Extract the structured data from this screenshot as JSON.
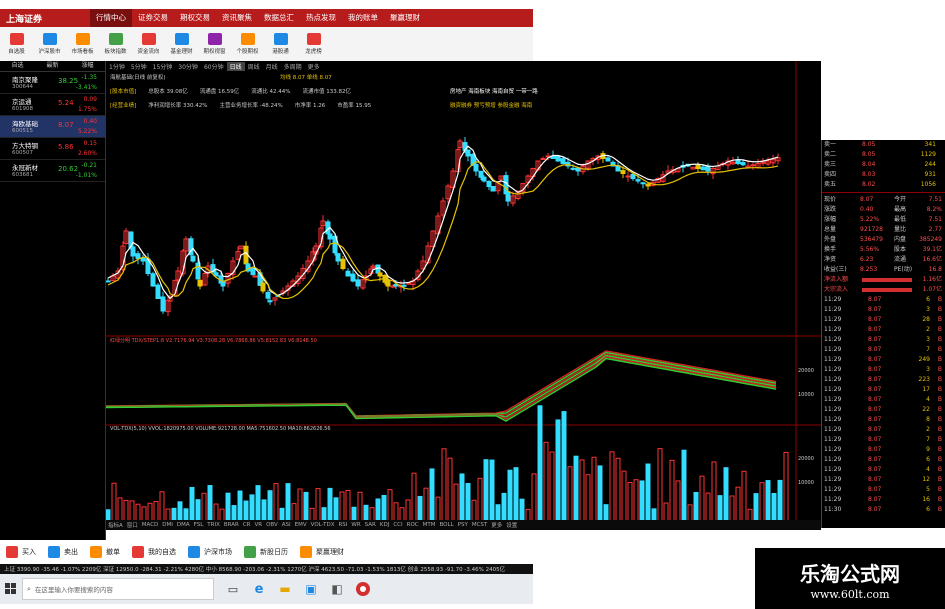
{
  "titlebar": {
    "logo": "上海证券",
    "menus": [
      "行情中心",
      "证券交易",
      "期权交易",
      "资讯聚焦",
      "数据总汇",
      "热点发现",
      "我的账单",
      "聚赢理财"
    ]
  },
  "toolbar": {
    "items": [
      {
        "label": "自选股",
        "color": "#e53935"
      },
      {
        "label": "沪深股市",
        "color": "#1e88e5"
      },
      {
        "label": "市场看板",
        "color": "#fb8c00"
      },
      {
        "label": "板块指数",
        "color": "#43a047"
      },
      {
        "label": "资金流向",
        "color": "#e53935"
      },
      {
        "label": "基金理财",
        "color": "#1e88e5"
      },
      {
        "label": "期权视窗",
        "color": "#8e24aa"
      },
      {
        "label": "个股期权",
        "color": "#fb8c00"
      },
      {
        "label": "港股通",
        "color": "#1e88e5"
      },
      {
        "label": "龙虎榜",
        "color": "#e53935"
      }
    ]
  },
  "watchlist": {
    "headers": [
      "自选",
      "最新",
      "涨幅"
    ],
    "items": [
      {
        "name": "南京聚隆",
        "code": "300644",
        "price": "38.25",
        "chg": "-1.35",
        "pct": "-3.41%",
        "color": "#33cc33"
      },
      {
        "name": "京运通",
        "code": "601908",
        "price": "5.24",
        "chg": "0.09",
        "pct": "1.75%",
        "color": "#ff3333"
      },
      {
        "name": "海欧基础",
        "code": "600515",
        "price": "8.07",
        "chg": "0.40",
        "pct": "5.22%",
        "color": "#ff3333"
      },
      {
        "name": "方大特钢",
        "code": "600507",
        "price": "5.86",
        "chg": "0.15",
        "pct": "2.60%",
        "color": "#ff3333"
      },
      {
        "name": "永冠新材",
        "code": "603681",
        "price": "20.62",
        "chg": "-0.21",
        "pct": "-1.01%",
        "color": "#33cc33"
      }
    ]
  },
  "periods": {
    "items": [
      "1分钟",
      "5分钟",
      "15分钟",
      "30分钟",
      "60分钟",
      "日线",
      "周线",
      "月线",
      "多周期",
      "更多"
    ],
    "active": "日线"
  },
  "stockinfo": {
    "title": "海航基础(日线 前复权)",
    "ma": "均线 8.07  单线 8.07"
  },
  "f10": {
    "row1": [
      "[股本市值]",
      "总股本 39.08亿",
      "流通盘 16.59亿",
      "流通比 42.44%",
      "流通市值 133.82亿",
      "房地产 海南板块 海南自贸 一带一路"
    ],
    "row2": [
      "[经营业绩]",
      "净利润增长率 330.42%",
      "主营业务增长率 -48.24%",
      "市净率 1.26",
      "市盈率 15.95",
      "融资融券 预亏预增 参股金融 海南"
    ]
  },
  "indicators": {
    "sub1": "红绿分明  TDX/STEP1:8  V2:7176.94  V3:7308.28  V6:7868.86  V5:8152.83  V6:8148.50",
    "sub2": "VOL-TDX(5,10)  VVOL:1820975.00  VOLUME:921728.00  MA5:751602.50  MA10:862626.56",
    "sub1_axis": [
      "20000",
      "10000"
    ],
    "sub2_axis": [
      "20000",
      "10000"
    ]
  },
  "indbar": [
    "指标A",
    "窗口",
    "MACD",
    "DMI",
    "DMA",
    "FSL",
    "TRIX",
    "BRAR",
    "CR",
    "VR",
    "OBV",
    "ASI",
    "EMV",
    "VOL-TDX",
    "RSI",
    "WR",
    "SAR",
    "KDJ",
    "CCI",
    "ROC",
    "MTM",
    "BOLL",
    "PSY",
    "MCST",
    "更多",
    "设置"
  ],
  "rightpanel": {
    "orders": [
      {
        "label": "卖一",
        "price": "8.05",
        "vol": "341"
      },
      {
        "label": "卖二",
        "price": "8.05",
        "vol": "1129"
      },
      {
        "label": "卖三",
        "price": "8.04",
        "vol": "244"
      },
      {
        "label": "卖四",
        "price": "8.03",
        "vol": "931"
      },
      {
        "label": "卖五",
        "price": "8.02",
        "vol": "1056"
      }
    ],
    "stats": [
      {
        "a": "现价",
        "b": "8.07",
        "c": "今开",
        "d": "7.51"
      },
      {
        "a": "涨跌",
        "b": "0.40",
        "c": "最高",
        "d": "8.2%"
      },
      {
        "a": "涨幅",
        "b": "5.22%",
        "c": "最低",
        "d": "7.51"
      },
      {
        "a": "总量",
        "b": "921728",
        "c": "量比",
        "d": "2.77"
      },
      {
        "a": "外盘",
        "b": "536479",
        "c": "内盘",
        "d": "385249"
      },
      {
        "a": "换手",
        "b": "5.56%",
        "c": "股本",
        "d": "39.1亿"
      },
      {
        "a": "净资",
        "b": "6.23",
        "c": "流通",
        "d": "16.6亿"
      },
      {
        "a": "收益(三)",
        "b": "8.253",
        "c": "PE(动)",
        "d": "16.8"
      }
    ],
    "flows": [
      {
        "label": "净流入额",
        "val": "1.16亿"
      },
      {
        "label": "大宗流入",
        "val": "1.07亿"
      }
    ],
    "ticks": [
      {
        "t": "11:29",
        "p": "8.07",
        "v": "6"
      },
      {
        "t": "11:29",
        "p": "8.07",
        "v": "3"
      },
      {
        "t": "11:29",
        "p": "8.07",
        "v": "28"
      },
      {
        "t": "11:29",
        "p": "8.07",
        "v": "2"
      },
      {
        "t": "11:29",
        "p": "8.07",
        "v": "3"
      },
      {
        "t": "11:29",
        "p": "8.07",
        "v": "7"
      },
      {
        "t": "11:29",
        "p": "8.07",
        "v": "249"
      },
      {
        "t": "11:29",
        "p": "8.07",
        "v": "3"
      },
      {
        "t": "11:29",
        "p": "8.07",
        "v": "223"
      },
      {
        "t": "11:29",
        "p": "8.07",
        "v": "17"
      },
      {
        "t": "11:29",
        "p": "8.07",
        "v": "4"
      },
      {
        "t": "11:29",
        "p": "8.07",
        "v": "22"
      },
      {
        "t": "11:29",
        "p": "8.07",
        "v": "8"
      },
      {
        "t": "11:29",
        "p": "8.07",
        "v": "2"
      },
      {
        "t": "11:29",
        "p": "8.07",
        "v": "7"
      },
      {
        "t": "11:29",
        "p": "8.07",
        "v": "9"
      },
      {
        "t": "11:29",
        "p": "8.07",
        "v": "6"
      },
      {
        "t": "11:29",
        "p": "8.07",
        "v": "4"
      },
      {
        "t": "11:29",
        "p": "8.07",
        "v": "12"
      },
      {
        "t": "11:29",
        "p": "8.07",
        "v": "5"
      },
      {
        "t": "11:29",
        "p": "8.07",
        "v": "16"
      },
      {
        "t": "11:30",
        "p": "8.07",
        "v": "6"
      }
    ]
  },
  "actions": [
    {
      "label": "买入",
      "color": "#e53935"
    },
    {
      "label": "卖出",
      "color": "#1e88e5"
    },
    {
      "label": "撤单",
      "color": "#fb8c00"
    },
    {
      "label": "我的自选",
      "color": "#e53935"
    },
    {
      "label": "沪深市场",
      "color": "#1e88e5"
    },
    {
      "label": "新股日历",
      "color": "#43a047"
    },
    {
      "label": "聚赢理财",
      "color": "#fb8c00"
    }
  ],
  "statusbar": "上证 3390.90 -35.46 -1.07% 2209亿   深证 12950.0 -284.31 -2.21% 4280亿   中小 8568.90 -203.06 -2.31% 1270亿   沪深 4623.50 -71.03 -1.53% 1813亿   创业 2558.93 -91.70 -3.46% 2405亿",
  "taskbar": {
    "search": "在这里输入你要搜索的内容"
  },
  "watermark": {
    "line1": "乐淘公式网",
    "line2": "www.60lt.com"
  }
}
